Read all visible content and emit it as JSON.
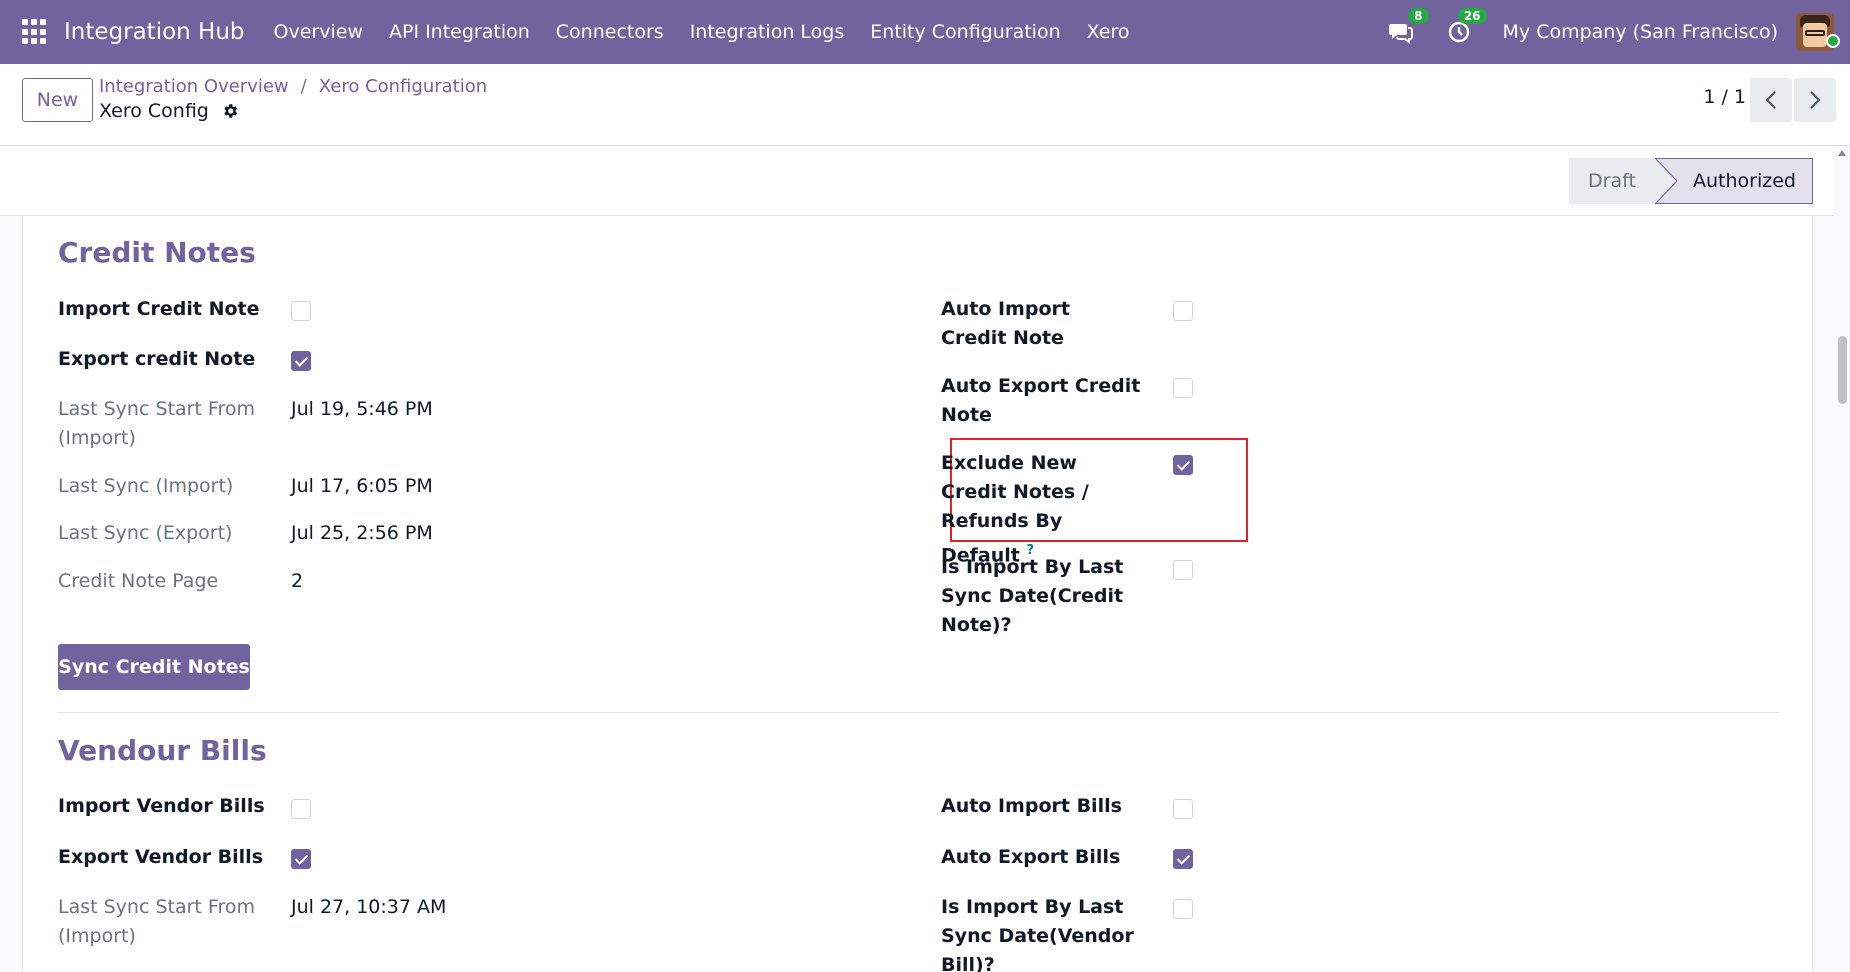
{
  "navbar": {
    "brand": "Integration Hub",
    "menu": [
      "Overview",
      "API Integration",
      "Connectors",
      "Integration Logs",
      "Entity Configuration",
      "Xero"
    ],
    "messages_count": "8",
    "activities_count": "26",
    "company": "My Company (San Francisco)"
  },
  "control_panel": {
    "new_label": "New",
    "breadcrumb": [
      "Integration Overview",
      "Xero Configuration"
    ],
    "breadcrumb_sep": "/",
    "record_title": "Xero Config",
    "pager": "1 / 1"
  },
  "statusbar": {
    "stages": [
      "Draft",
      "Authorized"
    ],
    "active_stage": "Authorized"
  },
  "credit_notes": {
    "title": "Credit Notes",
    "left": [
      {
        "label": "Import Credit Note",
        "type": "checkbox",
        "checked": false
      },
      {
        "label": "Export credit Note",
        "type": "checkbox",
        "checked": true
      },
      {
        "label": "Last Sync Start From (Import)",
        "type": "value",
        "value": "Jul 19, 5:46 PM"
      },
      {
        "label": "Last Sync (Import)",
        "type": "value",
        "value": "Jul 17, 6:05 PM"
      },
      {
        "label": "Last Sync (Export)",
        "type": "value",
        "value": "Jul 25, 2:56 PM"
      },
      {
        "label": "Credit Note Page",
        "type": "value",
        "value": "2"
      }
    ],
    "right": [
      {
        "label": "Auto Import Credit Note",
        "checked": false
      },
      {
        "label": "Auto Export Credit Note",
        "checked": false
      },
      {
        "label": "Exclude New Credit Notes / Refunds By Default",
        "checked": true,
        "help": "?"
      },
      {
        "label": "Is Import By Last Sync Date(Credit Note)?",
        "checked": false
      }
    ],
    "sync_button": "Sync Credit Notes"
  },
  "vendor_bills": {
    "title": "Vendour Bills",
    "left": [
      {
        "label": "Import Vendor Bills",
        "type": "checkbox",
        "checked": false
      },
      {
        "label": "Export Vendor Bills",
        "type": "checkbox",
        "checked": true
      },
      {
        "label": "Last Sync Start From (Import)",
        "type": "value",
        "value": "Jul 27, 10:37 AM"
      }
    ],
    "right": [
      {
        "label": "Auto Import Bills",
        "checked": false
      },
      {
        "label": "Auto Export Bills",
        "checked": true
      },
      {
        "label": "Is Import By Last Sync Date(Vendor Bill)?",
        "checked": false
      }
    ]
  },
  "colors": {
    "primary": "#71639e",
    "highlight": "#e02424",
    "badge": "#28a745"
  }
}
